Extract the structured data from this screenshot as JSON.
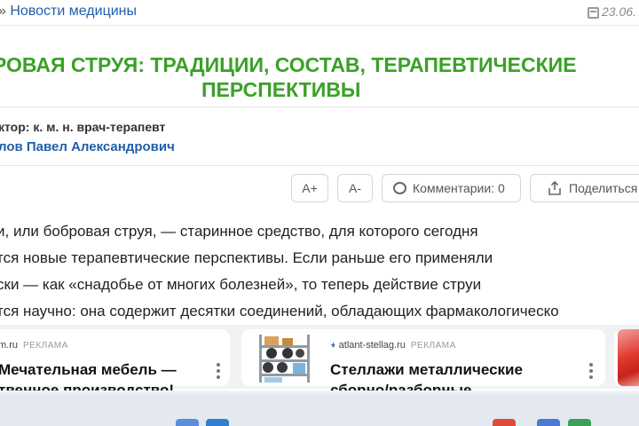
{
  "breadcrumb": {
    "arrow": "»",
    "label": "Новости медицины"
  },
  "date": "23.06.",
  "title": {
    "line1": "РОВАЯ СТРУЯ: ТРАДИЦИИ, СОСТАВ, ТЕРАПЕВТИЧЕСКИЕ",
    "line2": "ПЕРСПЕКТИВЫ"
  },
  "author": {
    "role": "ктор: к. м. н. врач-терапевт",
    "name": "лов Павел Александрович"
  },
  "toolbar": {
    "font_increase": "A+",
    "font_decrease": "A-",
    "comments": "Комментарии: 0",
    "share": "Поделиться"
  },
  "article": {
    "lines": [
      "и, или бобровая струя, — старинное средство, для которого сегодня",
      "тся новые терапевтические перспективы. Если раньше его применяли",
      "ски — как «снадобье от многих болезней», то теперь действие струи",
      "тся научно: она содержит десятки соединений, обладающих фармакологическо"
    ]
  },
  "ads": [
    {
      "source": "m.ru",
      "tag": "РЕКЛАМА",
      "line1": "Мечательная мебель —",
      "line2": "твенное производство!"
    },
    {
      "source": "atlant-stellag.ru",
      "tag": "РЕКЛАМА",
      "line1": "Стеллажи металлические",
      "line2": "сборно/разборные"
    }
  ],
  "colors": {
    "title": "#3aa127",
    "link": "#1f5fa8",
    "ad_strip": "#f1f2f4",
    "taskbar": "#e4e8ef"
  }
}
